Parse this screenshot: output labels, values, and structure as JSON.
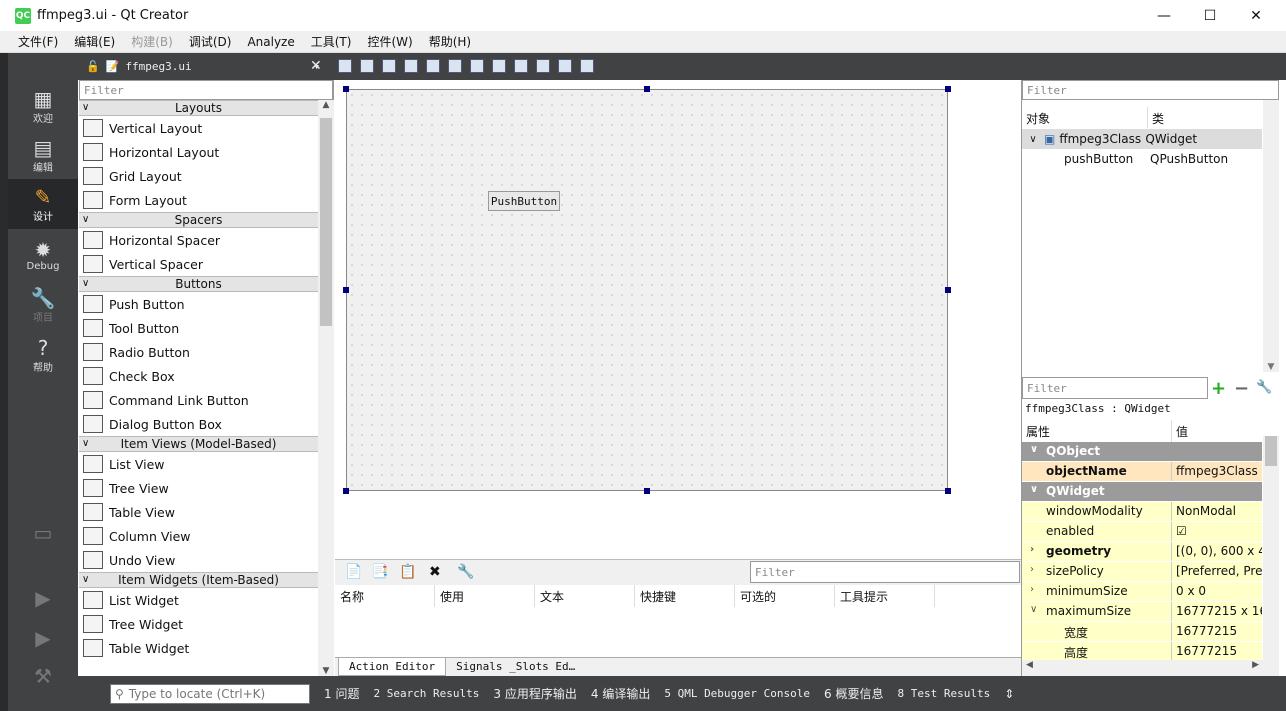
{
  "window": {
    "title": "ffmpeg3.ui - Qt Creator",
    "icon_text": "QC",
    "minimize": "—",
    "maximize": "☐",
    "close": "✕"
  },
  "menu": [
    "文件(F)",
    "编辑(E)",
    "构建(B)",
    "调试(D)",
    "Analyze",
    "工具(T)",
    "控件(W)",
    "帮助(H)"
  ],
  "modes": [
    {
      "label": "欢迎",
      "icon": "grid-icon"
    },
    {
      "label": "编辑",
      "icon": "document-icon"
    },
    {
      "label": "设计",
      "icon": "pencil-icon"
    },
    {
      "label": "Debug",
      "icon": "bug-icon"
    },
    {
      "label": "项目",
      "icon": "wrench-icon"
    },
    {
      "label": "帮助",
      "icon": "help-icon"
    }
  ],
  "doc_tab": {
    "name": "ffmpeg3.ui"
  },
  "widgetbox": {
    "filter_placeholder": "Filter",
    "categories": [
      {
        "name": "Layouts",
        "items": [
          "Vertical Layout",
          "Horizontal Layout",
          "Grid Layout",
          "Form Layout"
        ]
      },
      {
        "name": "Spacers",
        "items": [
          "Horizontal Spacer",
          "Vertical Spacer"
        ]
      },
      {
        "name": "Buttons",
        "items": [
          "Push Button",
          "Tool Button",
          "Radio Button",
          "Check Box",
          "Command Link Button",
          "Dialog Button Box"
        ]
      },
      {
        "name": "Item Views (Model-Based)",
        "items": [
          "List View",
          "Tree View",
          "Table View",
          "Column View",
          "Undo View"
        ]
      },
      {
        "name": "Item Widgets (Item-Based)",
        "items": [
          "List Widget",
          "Tree Widget",
          "Table Widget"
        ]
      }
    ]
  },
  "form": {
    "button_label": "PushButton"
  },
  "action_editor": {
    "filter_placeholder": "Filter",
    "columns": [
      "名称",
      "使用",
      "文本",
      "快捷键",
      "可选的",
      "工具提示"
    ],
    "tabs": [
      "Action Editor",
      "Signals _Slots Ed…"
    ]
  },
  "object_inspector": {
    "filter_placeholder": "Filter",
    "columns": [
      "对象",
      "类"
    ],
    "rows": [
      {
        "name": "ffmpeg3Class",
        "class": "QWidget"
      },
      {
        "name": "pushButton",
        "class": "QPushButton"
      }
    ]
  },
  "property_editor": {
    "filter_placeholder": "Filter",
    "context": "ffmpeg3Class : QWidget",
    "columns": [
      "属性",
      "值"
    ],
    "rows": [
      {
        "name": "QObject",
        "value": "",
        "group": true
      },
      {
        "name": "objectName",
        "value": "ffmpeg3Class"
      },
      {
        "name": "QWidget",
        "value": "",
        "group": true
      },
      {
        "name": "windowModality",
        "value": "NonModal"
      },
      {
        "name": "enabled",
        "value": "☑"
      },
      {
        "name": "geometry",
        "value": "[(0, 0), 600 x 4..."
      },
      {
        "name": "sizePolicy",
        "value": "[Preferred, Pre..."
      },
      {
        "name": "minimumSize",
        "value": "0 x 0"
      },
      {
        "name": "maximumSize",
        "value": "16777215 x 16..."
      },
      {
        "name": "宽度",
        "value": "16777215"
      },
      {
        "name": "高度",
        "value": "16777215"
      }
    ]
  },
  "statusbar": {
    "locate_placeholder": "Type to locate (Ctrl+K)",
    "items": [
      "1 问题",
      "2 Search Results",
      "3 应用程序输出",
      "4 编译输出",
      "5 QML Debugger Console",
      "6 概要信息",
      "8 Test Results"
    ]
  }
}
